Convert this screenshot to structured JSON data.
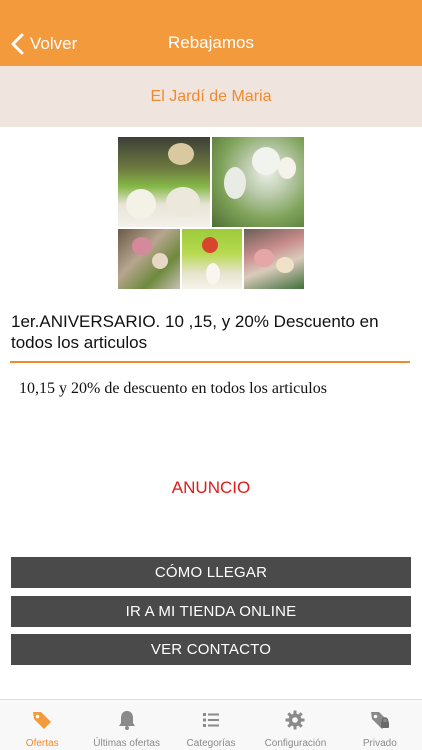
{
  "nav": {
    "back_label": "Volver",
    "title": "Rebajamos"
  },
  "store": {
    "name": "El Jardí de Maria"
  },
  "offer": {
    "headline": "1er.ANIVERSARIO.  10 ,15, y 20% Descuento en todos los articulos",
    "description": "10,15 y 20% de descuento en todos los articulos",
    "ad_label": "ANUNCIO"
  },
  "buttons": {
    "directions": "CÓMO LLEGAR",
    "online_store": "IR A MI TIENDA ONLINE",
    "contact": "VER CONTACTO"
  },
  "tabs": [
    {
      "label": "Ofertas",
      "icon": "tag-icon",
      "active": true
    },
    {
      "label": "Últimas ofertas",
      "icon": "bell-icon",
      "active": false
    },
    {
      "label": "Categorías",
      "icon": "list-icon",
      "active": false
    },
    {
      "label": "Configuración",
      "icon": "gear-icon",
      "active": false
    },
    {
      "label": "Privado",
      "icon": "private-tag-icon",
      "active": false
    }
  ],
  "colors": {
    "accent": "#f29a3c",
    "store_bar": "#f0e4df",
    "button": "#4a4a4a",
    "ad_text": "#e01b1b",
    "tab_inactive": "#8a8a8a"
  }
}
